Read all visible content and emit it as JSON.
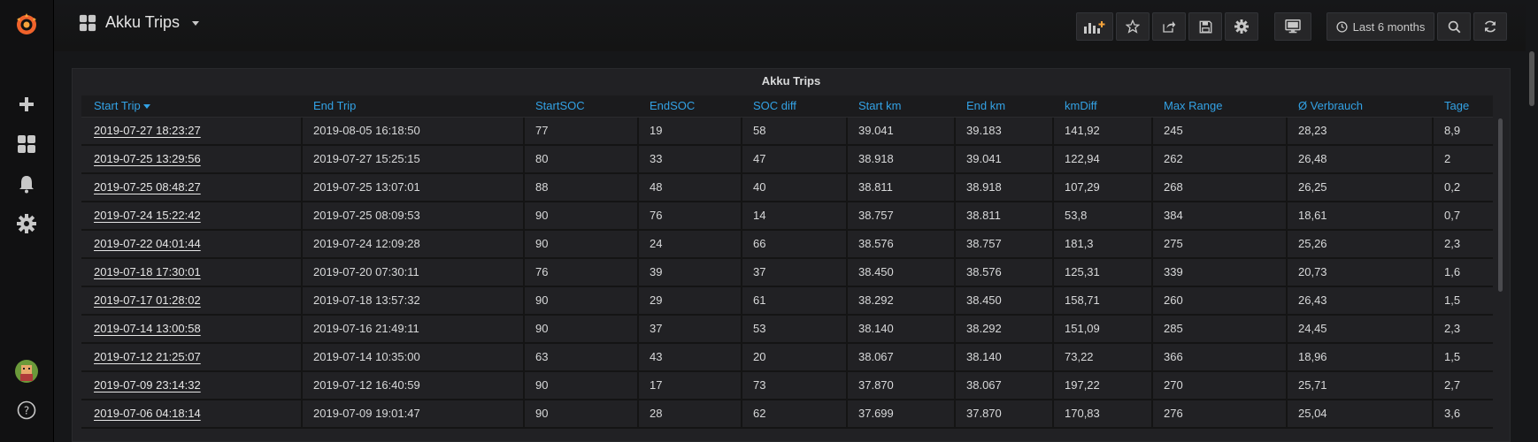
{
  "dashboard": {
    "title": "Akku Trips",
    "time_range": "Last 6 months"
  },
  "sidebar": {
    "icons": [
      "grafana-logo-icon",
      "plus-icon",
      "dashboards-icon",
      "bell-icon",
      "gear-icon",
      "avatar",
      "help-icon"
    ]
  },
  "navbar": {
    "buttons": [
      "add-panel-icon",
      "star-icon",
      "share-icon",
      "save-icon",
      "gear-icon",
      "tv-icon",
      "clock-icon",
      "zoom-out-icon",
      "refresh-icon"
    ]
  },
  "panel": {
    "title": "Akku Trips",
    "columns": [
      "Start Trip",
      "End Trip",
      "StartSOC",
      "EndSOC",
      "SOC diff",
      "Start km",
      "End km",
      "kmDiff",
      "Max Range",
      "Ø Verbrauch",
      "Tage"
    ],
    "rows": [
      [
        "2019-07-27 18:23:27",
        "2019-08-05 16:18:50",
        "77",
        "19",
        "58",
        "39.041",
        "39.183",
        "141,92",
        "245",
        "28,23",
        "8,9"
      ],
      [
        "2019-07-25 13:29:56",
        "2019-07-27 15:25:15",
        "80",
        "33",
        "47",
        "38.918",
        "39.041",
        "122,94",
        "262",
        "26,48",
        "2"
      ],
      [
        "2019-07-25 08:48:27",
        "2019-07-25 13:07:01",
        "88",
        "48",
        "40",
        "38.811",
        "38.918",
        "107,29",
        "268",
        "26,25",
        "0,2"
      ],
      [
        "2019-07-24 15:22:42",
        "2019-07-25 08:09:53",
        "90",
        "76",
        "14",
        "38.757",
        "38.811",
        "53,8",
        "384",
        "18,61",
        "0,7"
      ],
      [
        "2019-07-22 04:01:44",
        "2019-07-24 12:09:28",
        "90",
        "24",
        "66",
        "38.576",
        "38.757",
        "181,3",
        "275",
        "25,26",
        "2,3"
      ],
      [
        "2019-07-18 17:30:01",
        "2019-07-20 07:30:11",
        "76",
        "39",
        "37",
        "38.450",
        "38.576",
        "125,31",
        "339",
        "20,73",
        "1,6"
      ],
      [
        "2019-07-17 01:28:02",
        "2019-07-18 13:57:32",
        "90",
        "29",
        "61",
        "38.292",
        "38.450",
        "158,71",
        "260",
        "26,43",
        "1,5"
      ],
      [
        "2019-07-14 13:00:58",
        "2019-07-16 21:49:11",
        "90",
        "37",
        "53",
        "38.140",
        "38.292",
        "151,09",
        "285",
        "24,45",
        "2,3"
      ],
      [
        "2019-07-12 21:25:07",
        "2019-07-14 10:35:00",
        "63",
        "43",
        "20",
        "38.067",
        "38.140",
        "73,22",
        "366",
        "18,96",
        "1,5"
      ],
      [
        "2019-07-09 23:14:32",
        "2019-07-12 16:40:59",
        "90",
        "17",
        "73",
        "37.870",
        "38.067",
        "197,22",
        "270",
        "25,71",
        "2,7"
      ],
      [
        "2019-07-06 04:18:14",
        "2019-07-09 19:01:47",
        "90",
        "28",
        "62",
        "37.699",
        "37.870",
        "170,83",
        "276",
        "25,04",
        "3,6"
      ]
    ]
  },
  "colors": {
    "background": "#161719",
    "panel": "#212124",
    "header_text": "#33a2e5",
    "text": "#d8d9da",
    "logo_orange": "#f0632b"
  }
}
